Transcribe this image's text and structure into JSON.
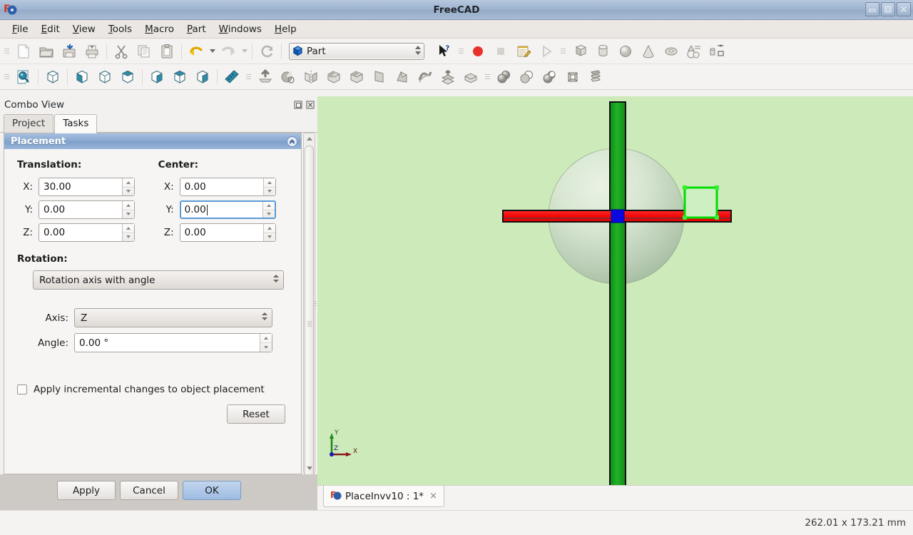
{
  "window": {
    "title": "FreeCAD",
    "icon": "freecad-logo-icon",
    "buttons": {
      "minimize": "minimize-button",
      "maximize": "maximize-button",
      "close": "close-button"
    }
  },
  "menubar": {
    "items": [
      {
        "label": "File",
        "mnemonic": "F"
      },
      {
        "label": "Edit",
        "mnemonic": "E"
      },
      {
        "label": "View",
        "mnemonic": "V"
      },
      {
        "label": "Tools",
        "mnemonic": "T"
      },
      {
        "label": "Macro",
        "mnemonic": "M"
      },
      {
        "label": "Part",
        "mnemonic": "P"
      },
      {
        "label": "Windows",
        "mnemonic": "W"
      },
      {
        "label": "Help",
        "mnemonic": "H"
      }
    ]
  },
  "toolbars": {
    "file": [
      "new-document-icon",
      "open-document-icon",
      "save-document-icon",
      "print-document-icon",
      "cut-icon",
      "copy-icon",
      "paste-icon",
      "undo-icon",
      "undo-dropdown-icon",
      "redo-icon",
      "redo-dropdown-icon",
      "refresh-icon"
    ],
    "workbench_selector": {
      "label": "Part",
      "icon": "part-workbench-icon"
    },
    "macro": [
      "whats-this-icon",
      "macro-record-icon",
      "macro-stop-icon",
      "macro-edit-icon",
      "macro-execute-icon"
    ],
    "primitives": [
      "box-icon",
      "cylinder-icon",
      "sphere-icon",
      "cone-icon",
      "torus-icon",
      "create-primitives-icon",
      "shape-builder-icon"
    ],
    "view": [
      "fit-all-icon",
      "axonometric-icon",
      "front-view-icon",
      "top-view-icon",
      "right-view-icon",
      "rear-view-icon",
      "bottom-view-icon",
      "left-view-icon",
      "measure-icon",
      "extrude-icon"
    ],
    "part_ops": [
      "revolve-icon",
      "mirror-icon",
      "fillet-icon",
      "chamfer-icon",
      "ruled-surface-icon",
      "loft-icon",
      "sweep-icon",
      "section-icon",
      "cross-sections-icon",
      "boolean-icon",
      "cut-boolean-icon",
      "union-icon",
      "intersection-icon",
      "join-icon",
      "split-icon"
    ]
  },
  "combo_view": {
    "title": "Combo View",
    "float_button": "undock-icon",
    "close_button": "close-panel-icon",
    "tabs": [
      {
        "label": "Project",
        "active": false
      },
      {
        "label": "Tasks",
        "active": true
      }
    ]
  },
  "placement": {
    "header": "Placement",
    "collapse_icon": "collapse-chevron-icon",
    "translation": {
      "label": "Translation:",
      "fields": [
        {
          "axis": "X:",
          "value": "30.00",
          "focused": false
        },
        {
          "axis": "Y:",
          "value": "0.00",
          "focused": false
        },
        {
          "axis": "Z:",
          "value": "0.00",
          "focused": false
        }
      ]
    },
    "center": {
      "label": "Center:",
      "fields": [
        {
          "axis": "X:",
          "value": "0.00",
          "focused": false
        },
        {
          "axis": "Y:",
          "value": "0.00",
          "focused": true
        },
        {
          "axis": "Z:",
          "value": "0.00",
          "focused": false
        }
      ]
    },
    "rotation": {
      "label": "Rotation:",
      "mode": "Rotation axis with angle",
      "axis_label": "Axis:",
      "axis_value": "Z",
      "angle_label": "Angle:",
      "angle_value": "0.00 °"
    },
    "incremental": {
      "label": "Apply incremental changes to object placement",
      "checked": false
    },
    "reset_label": "Reset"
  },
  "dialog_buttons": {
    "apply": "Apply",
    "cancel": "Cancel",
    "ok": "OK",
    "default": "ok"
  },
  "viewport": {
    "background_color": "#cdeaba",
    "objects": [
      {
        "name": "sphere",
        "color": "#cfe0cb",
        "shape": "sphere"
      },
      {
        "name": "green-box-vertical",
        "color": "#17a117",
        "shape": "box"
      },
      {
        "name": "red-box-horizontal",
        "color": "#f30f0f",
        "shape": "box"
      },
      {
        "name": "blue-box-center",
        "color": "#0a0ae0",
        "shape": "box"
      },
      {
        "name": "selected-green-box",
        "color": "#00e500",
        "shape": "box",
        "selected": true
      }
    ],
    "axis_cross": {
      "x_label": "X",
      "x_color": "#8b1a1a",
      "y_label": "Y",
      "y_color": "#1a7a1a",
      "z_label": "Z",
      "z_color": "#1a1a8b"
    }
  },
  "mdi": {
    "tabs": [
      {
        "label": "PlaceInvv10 : 1*",
        "icon": "freecad-document-icon",
        "close": "×"
      }
    ]
  },
  "statusbar": {
    "dimensions": "262.01 x 173.21 mm"
  }
}
